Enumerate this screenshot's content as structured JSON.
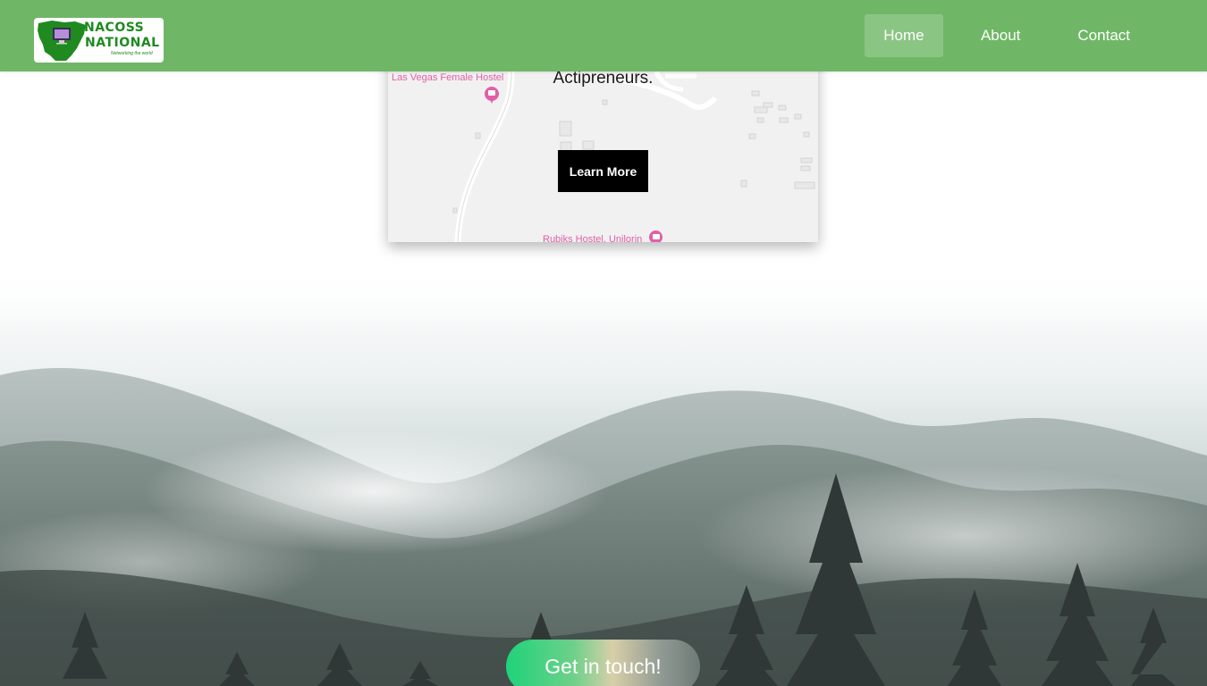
{
  "header": {
    "logo": {
      "title_line1": "NACOSS",
      "title_line2": "NATIONAL",
      "tagline": "Networking the world"
    },
    "nav": {
      "items": [
        {
          "label": "Home",
          "active": true
        },
        {
          "label": "About",
          "active": false
        },
        {
          "label": "Contact",
          "active": false
        }
      ]
    }
  },
  "map_card": {
    "text": "Actipreneurs.",
    "button_label": "Learn More",
    "places": [
      {
        "label": "Las Vegas Female Hostel",
        "icon": "hostel-pin-icon"
      },
      {
        "label": "Rubiks Hostel, Unilorin",
        "icon": "hostel-pin-icon"
      }
    ]
  },
  "hero": {
    "cta_label": "Get in touch!"
  },
  "colors": {
    "header_bg": "#6fb766",
    "logo_green": "#1f8a1f",
    "map_pin": "#e15fa8",
    "button_bg": "#000000",
    "cta_start": "#1ed37a",
    "cta_end": "#6d7a75"
  }
}
